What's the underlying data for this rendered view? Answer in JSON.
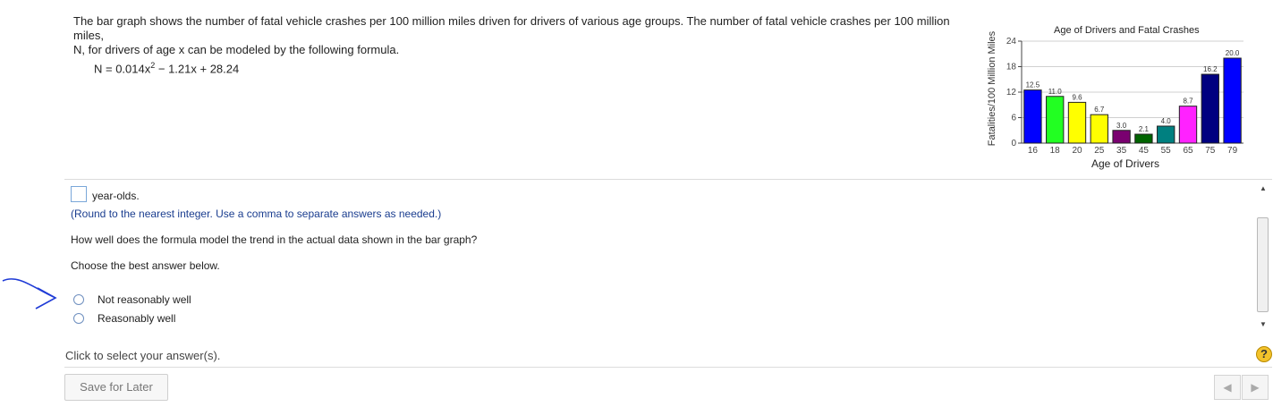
{
  "problem": {
    "line1": "The bar graph shows the number of fatal vehicle crashes per 100 million miles driven for drivers of various age groups. The number of fatal vehicle crashes per 100 million miles,",
    "line2": "N, for drivers of age x can be modeled by the following formula.",
    "formula_prefix": "N = 0.014x",
    "formula_exp": "2",
    "formula_suffix": " − 1.21x + 28.24"
  },
  "answer": {
    "unit_text": "year-olds.",
    "hint": "(Round to the nearest integer. Use a comma to separate answers as needed.)",
    "question": "How well does the formula model the trend in the actual data shown in the bar graph?",
    "instruction": "Choose the best answer below.",
    "options": [
      {
        "label": "Not reasonably well"
      },
      {
        "label": "Reasonably well"
      }
    ]
  },
  "footer": {
    "status": "Click to select your answer(s).",
    "save_label": "Save for Later",
    "help_label": "?",
    "prev_icon": "triangle-left",
    "next_icon": "triangle-right"
  },
  "chart_data": {
    "type": "bar",
    "title": "Age of Drivers and Fatal Crashes",
    "xlabel": "Age of Drivers",
    "ylabel": "Fatalities/100 Million Miles",
    "x_ticks": [
      "16",
      "18",
      "20",
      "25",
      "35",
      "45",
      "55",
      "65",
      "75",
      "79"
    ],
    "values": [
      12.5,
      11.0,
      9.6,
      6.7,
      3.0,
      2.1,
      4.0,
      8.7,
      16.2,
      20.0
    ],
    "value_labels": [
      "12.5",
      "11.0",
      "9.6",
      "6.7",
      "3.0",
      "2.1",
      "4.0",
      "8.7",
      "16.2",
      "20.0"
    ],
    "colors": [
      "#0000ff",
      "#22ff22",
      "#ffff00",
      "#ffff00",
      "#7a0070",
      "#006400",
      "#008080",
      "#ff22ff",
      "#000080",
      "#0000ff"
    ],
    "ylim": [
      0,
      24
    ],
    "y_ticks": [
      "0",
      "6",
      "12",
      "18",
      "24"
    ],
    "grid": true
  }
}
